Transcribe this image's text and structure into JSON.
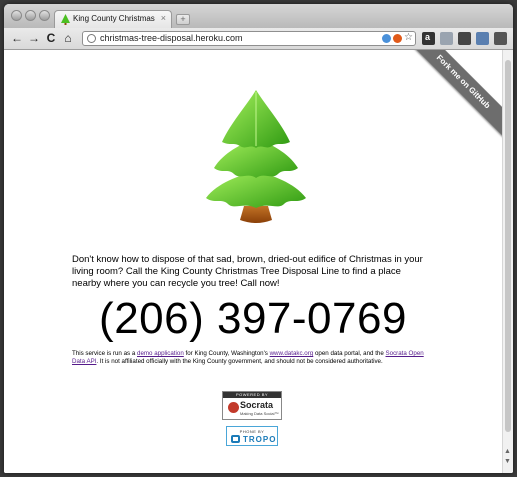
{
  "browser": {
    "tab_title": "King County Christmas Tree",
    "tab_close": "×",
    "new_tab": "+",
    "url": "christmas-tree-disposal.heroku.com",
    "nav": {
      "back": "←",
      "forward": "→",
      "reload": "C",
      "home": "⌂"
    }
  },
  "page": {
    "ribbon": "Fork me on GitHub",
    "description": "Don't know how to dispose of that sad, brown, dried-out edifice of Christmas in your living room? Call the King County Christmas Tree Disposal Line to find a place nearby where you can recycle you tree! Call now!",
    "phone": "(206) 397-0769",
    "fine_print": {
      "t1": "This service is run as a ",
      "link1": "demo application",
      "t2": " for King County, Washington's ",
      "link2": "www.datakc.org",
      "t3": " open data portal, and the ",
      "link3": "Socrata Open Data API",
      "t4": ". It is not affiliated officially with the King County government, and should not be considered authoritative."
    },
    "socrata": {
      "top": "POWERED BY",
      "name": "Socrata",
      "sub": "Making Data Social™"
    },
    "tropo": {
      "top": "PHONE BY",
      "name": "TROPO"
    }
  },
  "colors": {
    "tree_light": "#7ee83a",
    "tree_dark": "#2f9a12",
    "trunk": "#b25a12",
    "ribbon": "#6d6d6d"
  }
}
